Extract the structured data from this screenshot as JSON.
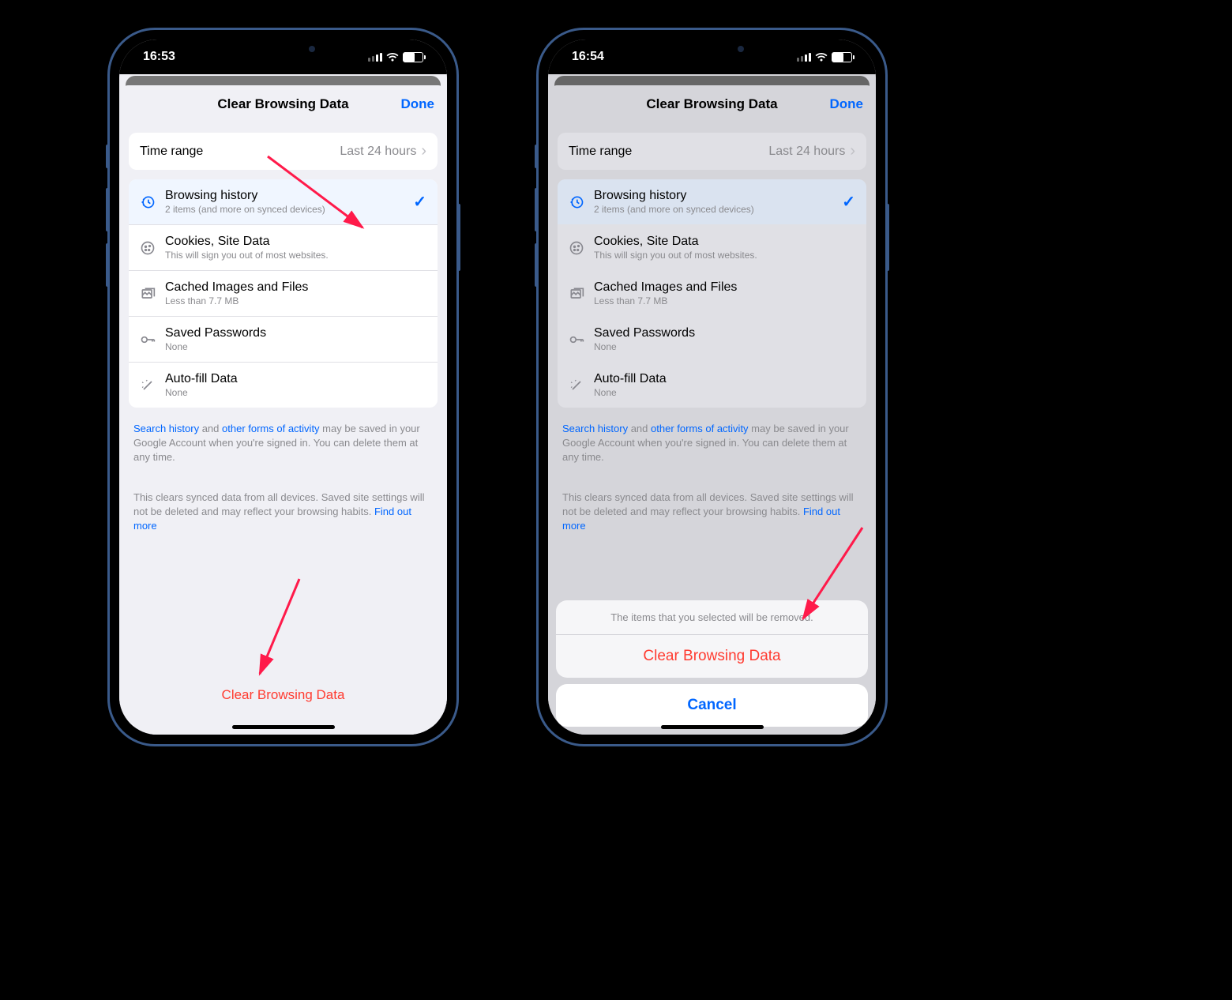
{
  "left": {
    "time": "16:53",
    "title": "Clear Browsing Data",
    "done": "Done",
    "time_range": {
      "label": "Time range",
      "value": "Last 24 hours"
    },
    "items": [
      {
        "title": "Browsing history",
        "sub": "2 items (and more on synced devices)",
        "selected": true
      },
      {
        "title": "Cookies, Site Data",
        "sub": "This will sign you out of most websites."
      },
      {
        "title": "Cached Images and Files",
        "sub": "Less than 7.7 MB"
      },
      {
        "title": "Saved Passwords",
        "sub": "None"
      },
      {
        "title": "Auto-fill Data",
        "sub": "None"
      }
    ],
    "info1_link1": "Search history",
    "info1_mid": " and ",
    "info1_link2": "other forms of activity",
    "info1_rest": " may be saved in your Google Account when you're signed in. You can delete them at any time.",
    "info2_text": "This clears synced data from all devices. Saved site settings will not be deleted and may reflect your browsing habits. ",
    "info2_link": "Find out more",
    "clear_btn": "Clear Browsing Data"
  },
  "right": {
    "time": "16:54",
    "title": "Clear Browsing Data",
    "done": "Done",
    "time_range": {
      "label": "Time range",
      "value": "Last 24 hours"
    },
    "items": [
      {
        "title": "Browsing history",
        "sub": "2 items (and more on synced devices)",
        "selected": true
      },
      {
        "title": "Cookies, Site Data",
        "sub": "This will sign you out of most websites."
      },
      {
        "title": "Cached Images and Files",
        "sub": "Less than 7.7 MB"
      },
      {
        "title": "Saved Passwords",
        "sub": "None"
      },
      {
        "title": "Auto-fill Data",
        "sub": "None"
      }
    ],
    "info1_link1": "Search history",
    "info1_mid": " and ",
    "info1_link2": "other forms of activity",
    "info1_rest": " may be saved in your Google Account when you're signed in. You can delete them at any time.",
    "info2_text": "This clears synced data from all devices. Saved site settings will not be deleted and may reflect your browsing habits. ",
    "info2_link": "Find out more",
    "sheet_msg": "The items that you selected will be removed.",
    "sheet_clear": "Clear Browsing Data",
    "sheet_cancel": "Cancel"
  }
}
